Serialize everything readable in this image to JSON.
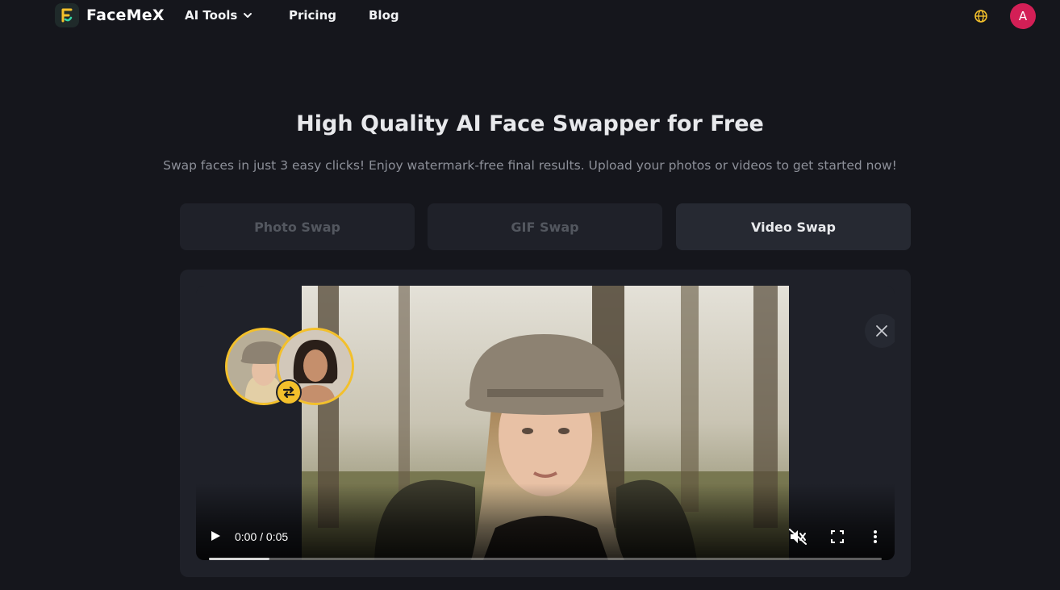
{
  "brand": {
    "name": "FaceMeX",
    "accent": "#f3c02b",
    "avatar_color": "#d31f56"
  },
  "nav": {
    "ai_tools": "AI Tools",
    "pricing": "Pricing",
    "blog": "Blog"
  },
  "user": {
    "avatar_initial": "A"
  },
  "hero": {
    "title": "High Quality AI Face Swapper for Free",
    "subtitle": "Swap faces in just 3 easy clicks! Enjoy watermark-free final results. Upload your photos or videos to get started now!"
  },
  "tabs": [
    {
      "label": "Photo Swap",
      "active": false
    },
    {
      "label": "GIF Swap",
      "active": false
    },
    {
      "label": "Video Swap",
      "active": true
    }
  ],
  "player": {
    "time": "0:00 / 0:05",
    "buffered_fraction": 0.09,
    "muted": true
  },
  "icons": {
    "logo": "facemex-logo-icon",
    "dropdown": "chevron-down-icon",
    "language": "globe-icon",
    "close": "close-icon",
    "swap": "swap-arrows-icon",
    "play": "play-icon",
    "mute": "volume-muted-icon",
    "fullscreen": "fullscreen-icon",
    "more": "more-vertical-icon"
  }
}
